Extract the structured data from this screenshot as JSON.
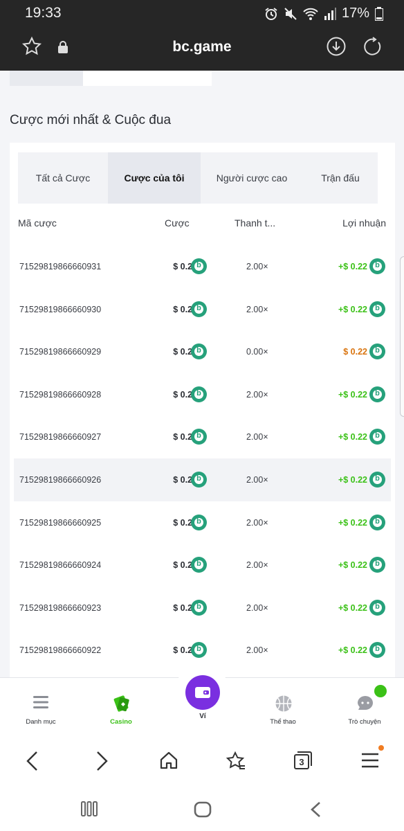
{
  "status_bar": {
    "time": "19:33",
    "battery": "17%"
  },
  "browser": {
    "url_title": "bc.game"
  },
  "section": {
    "title": "Cược mới nhất & Cuộc đua"
  },
  "tabs": [
    {
      "label": "Tất cả Cược",
      "active": false
    },
    {
      "label": "Cược của tôi",
      "active": true
    },
    {
      "label": "Người cược cao",
      "active": false
    },
    {
      "label": "Trận đấu",
      "active": false
    }
  ],
  "table": {
    "headers": {
      "id": "Mã cược",
      "bet": "Cược",
      "payout": "Thanh t...",
      "profit": "Lợi nhuận"
    },
    "rows": [
      {
        "id": "7152981986666093​1",
        "bet": "$ 0.22",
        "mult": "2.00×",
        "profit": "+$ 0.22",
        "win": true
      },
      {
        "id": "71529819866660930",
        "bet": "$ 0.22",
        "mult": "2.00×",
        "profit": "+$ 0.22",
        "win": true
      },
      {
        "id": "71529819866660929",
        "bet": "$ 0.22",
        "mult": "0.00×",
        "profit": "$ 0.22",
        "win": false
      },
      {
        "id": "71529819866660928",
        "bet": "$ 0.22",
        "mult": "2.00×",
        "profit": "+$ 0.22",
        "win": true
      },
      {
        "id": "71529819866660927",
        "bet": "$ 0.22",
        "mult": "2.00×",
        "profit": "+$ 0.22",
        "win": true
      },
      {
        "id": "71529819866660926",
        "bet": "$ 0.22",
        "mult": "2.00×",
        "profit": "+$ 0.22",
        "win": true
      },
      {
        "id": "71529819866660925",
        "bet": "$ 0.22",
        "mult": "2.00×",
        "profit": "+$ 0.22",
        "win": true
      },
      {
        "id": "71529819866660924",
        "bet": "$ 0.22",
        "mult": "2.00×",
        "profit": "+$ 0.22",
        "win": true
      },
      {
        "id": "71529819866660923",
        "bet": "$ 0.22",
        "mult": "2.00×",
        "profit": "+$ 0.22",
        "win": true
      },
      {
        "id": "71529819866660922",
        "bet": "$ 0.22",
        "mult": "2.00×",
        "profit": "+$ 0.22",
        "win": true
      }
    ]
  },
  "app_nav": {
    "menu": "Danh mục",
    "casino": "Casino",
    "wallet": "Ví",
    "sports": "Thể thao",
    "chat": "Trò chuyện"
  },
  "browser_bar": {
    "tab_count": "3"
  },
  "colors": {
    "win": "#3bc117",
    "loss": "#d9740f",
    "coin": "#26a17b",
    "wallet": "#7a2fe0"
  }
}
